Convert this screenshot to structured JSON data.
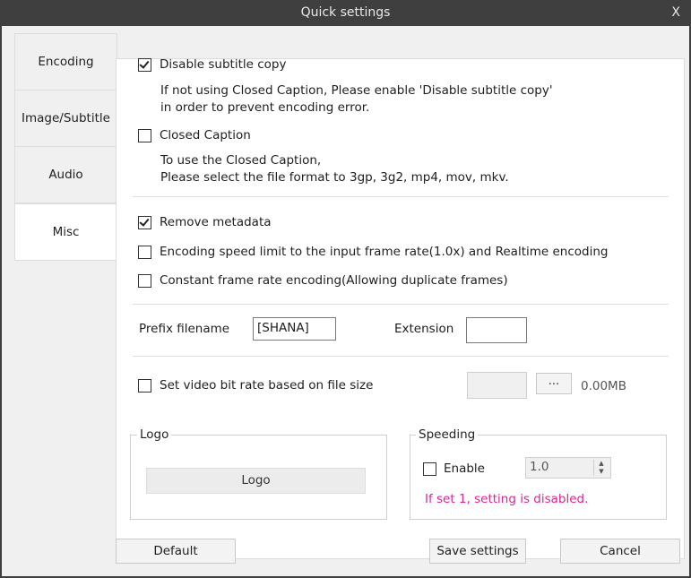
{
  "window": {
    "title": "Quick settings",
    "close": "X"
  },
  "tabs": [
    {
      "label": "Encoding"
    },
    {
      "label": "Image/Subtitle"
    },
    {
      "label": "Audio"
    },
    {
      "label": "Misc",
      "active": true
    }
  ],
  "options": {
    "disable_subtitle": {
      "label": "Disable subtitle copy",
      "checked": true,
      "desc1": "If not using Closed Caption, Please enable 'Disable subtitle copy'",
      "desc2": "in order to prevent encoding error."
    },
    "closed_caption": {
      "label": "Closed Caption",
      "checked": false,
      "desc1": "To use the Closed Caption,",
      "desc2": "Please select the file format to 3gp, 3g2, mp4, mov, mkv."
    },
    "remove_metadata": {
      "label": "Remove metadata",
      "checked": true
    },
    "speed_limit": {
      "label": "Encoding speed limit to the input frame rate(1.0x) and Realtime encoding",
      "checked": false
    },
    "constant_fr": {
      "label": "Constant frame rate encoding(Allowing duplicate frames)",
      "checked": false
    }
  },
  "prefix": {
    "label": "Prefix filename",
    "value": "[SHANA]"
  },
  "extension": {
    "label": "Extension",
    "value": ""
  },
  "bitrate": {
    "label": "Set video bit rate based on file size",
    "checked": false,
    "value": "",
    "browse": "...",
    "size": "0.00MB"
  },
  "logo": {
    "group_title": "Logo",
    "button": "Logo"
  },
  "speeding": {
    "group_title": "Speeding",
    "enable_label": "Enable",
    "checked": false,
    "value": "1.0",
    "warning": "If set 1, setting is disabled."
  },
  "footer": {
    "default": "Default",
    "save": "Save settings",
    "cancel": "Cancel"
  },
  "colors": {
    "titlebar": "#3f3f3f",
    "warning": "#e0268e"
  }
}
